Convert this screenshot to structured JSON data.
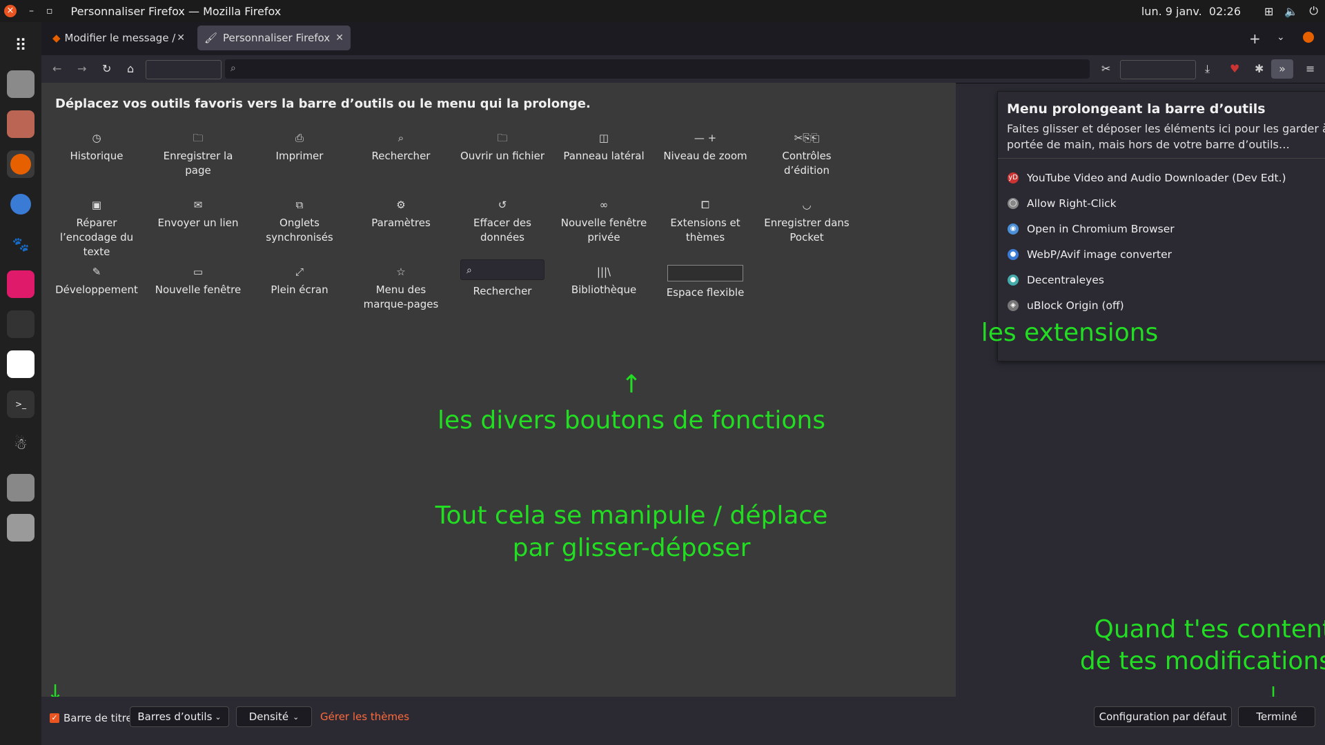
{
  "system": {
    "window_title": "Personnaliser Firefox — Mozilla Firefox",
    "date": "lun. 9 janv.",
    "time": "02:26"
  },
  "tabs": [
    {
      "label": "Modifier le message / For"
    },
    {
      "label": "Personnaliser Firefox"
    }
  ],
  "palette": {
    "intro": "Déplacez vos outils favoris vers la barre d’outils ou le menu qui la prolonge.",
    "items": [
      {
        "icon": "◷",
        "label": "Historique"
      },
      {
        "icon": "🗀",
        "label": "Enregistrer la page"
      },
      {
        "icon": "⎙",
        "label": "Imprimer"
      },
      {
        "icon": "⌕",
        "label": "Rechercher"
      },
      {
        "icon": "🗀",
        "label": "Ouvrir un fichier"
      },
      {
        "icon": "◫",
        "label": "Panneau latéral"
      },
      {
        "icon": "—  +",
        "label": "Niveau de zoom"
      },
      {
        "icon": "✂⎘⎗",
        "label": "Contrôles d’édition"
      },
      {
        "icon": "▣",
        "label": "Réparer l’encodage du texte"
      },
      {
        "icon": "✉",
        "label": "Envoyer un lien"
      },
      {
        "icon": "⧉",
        "label": "Onglets synchronisés"
      },
      {
        "icon": "⚙",
        "label": "Paramètres"
      },
      {
        "icon": "↺",
        "label": "Effacer des données"
      },
      {
        "icon": "∞",
        "label": "Nouvelle fenêtre privée"
      },
      {
        "icon": "⧠",
        "label": "Extensions et thèmes"
      },
      {
        "icon": "◡",
        "label": "Enregistrer dans Pocket"
      },
      {
        "icon": "✎",
        "label": "Développement"
      },
      {
        "icon": "▭",
        "label": "Nouvelle fenêtre"
      },
      {
        "icon": "⤢",
        "label": "Plein écran"
      },
      {
        "icon": "☆",
        "label": "Menu des marque-pages"
      },
      {
        "icon": "⌕",
        "label": "Rechercher"
      },
      {
        "icon": "|||\\",
        "label": "Bibliothèque"
      },
      {
        "icon": "",
        "label": "Espace flexible"
      }
    ]
  },
  "overflow": {
    "heading": "Menu prolongeant la barre d’outils",
    "description": "Faites glisser et déposer les éléments ici pour les garder à portée de main, mais hors de votre barre d’outils…",
    "extensions": [
      {
        "label": "YouTube Video and Audio Downloader (Dev Edt.)",
        "icon": "yD",
        "color": "#c33"
      },
      {
        "label": "Allow Right-Click",
        "icon": "◯",
        "color": "#888"
      },
      {
        "label": "Open in Chromium Browser",
        "icon": "◉",
        "color": "#4a8fd8"
      },
      {
        "label": "WebP/Avif image converter",
        "icon": "●",
        "color": "#3b7bd4"
      },
      {
        "label": "Decentraleyes",
        "icon": "●",
        "color": "#4aa"
      },
      {
        "label": "uBlock Origin (off)",
        "icon": "◈",
        "color": "#777"
      }
    ]
  },
  "annotations": {
    "extensions": "les extensions",
    "buttons": "les divers boutons de fonctions",
    "dragdrop_1": "Tout cela se manipule / déplace",
    "dragdrop_2": "par glisser-déposer",
    "done_1": "Quand t'es content",
    "done_2": "de tes modifications",
    "arrow_up": "↑",
    "arrow_down": "↓",
    "color": "#22dd22"
  },
  "bottom": {
    "titlebar_label": "Barre de titre",
    "toolbars_label": "Barres d’outils",
    "density_label": "Densité",
    "themes_link": "Gérer les thèmes",
    "reset_label": "Configuration par défaut",
    "done_label": "Terminé"
  },
  "colors": {
    "accent": "#e95420",
    "link": "#ff6a3d"
  }
}
